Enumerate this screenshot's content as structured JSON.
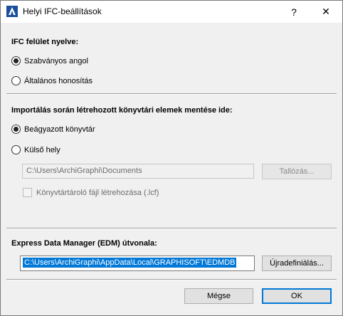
{
  "window": {
    "title": "Helyi IFC-beállítások",
    "help_label": "?",
    "close_label": "✕",
    "app_icon": "archicad-icon"
  },
  "language_section": {
    "heading": "IFC felület nyelve:",
    "options": [
      {
        "label": "Szabványos angol",
        "selected": true
      },
      {
        "label": "Általános honosítás",
        "selected": false
      }
    ]
  },
  "library_section": {
    "heading": "Importálás során létrehozott könyvtári elemek mentése ide:",
    "options": [
      {
        "label": "Beágyazott könyvtár",
        "selected": true
      },
      {
        "label": "Külső hely",
        "selected": false
      }
    ],
    "path_value": "C:\\Users\\ArchiGraphi\\Documents",
    "browse_label": "Tallózás...",
    "container_checkbox_label": "Könyvtártároló fájl létrehozása (.lcf)",
    "container_checked": false
  },
  "edm_section": {
    "heading": "Express Data Manager (EDM) útvonala:",
    "path_value": "C:\\Users\\ArchiGraphi\\AppData\\Local\\GRAPHISOFT\\EDMDB",
    "redefine_label": "Újradefiniálás..."
  },
  "footer": {
    "cancel_label": "Mégse",
    "ok_label": "OK"
  },
  "colors": {
    "accent": "#0078d7",
    "dialog_bg": "#f0f0f0"
  }
}
